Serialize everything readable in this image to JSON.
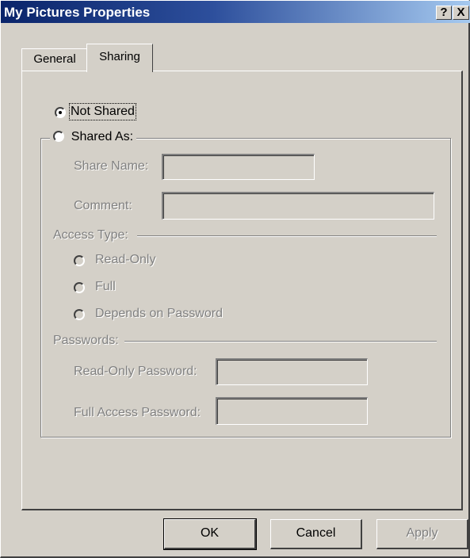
{
  "window": {
    "title": "My Pictures Properties",
    "help_label": "?",
    "close_label": "X"
  },
  "tabs": [
    {
      "label": "General",
      "selected": false
    },
    {
      "label": "Sharing",
      "selected": true
    }
  ],
  "sharing": {
    "not_shared": {
      "label": "Not Shared",
      "checked": true
    },
    "shared_as": {
      "label": "Shared As:",
      "checked": false
    },
    "share_name": {
      "label": "Share Name:",
      "value": ""
    },
    "comment": {
      "label": "Comment:",
      "value": ""
    },
    "access_type": {
      "label": "Access Type:",
      "options": [
        {
          "label": "Read-Only",
          "checked": false
        },
        {
          "label": "Full",
          "checked": false
        },
        {
          "label": "Depends on Password",
          "checked": false
        }
      ]
    },
    "passwords": {
      "label": "Passwords:",
      "read_only_password": {
        "label": "Read-Only Password:",
        "value": ""
      },
      "full_access_password": {
        "label": "Full Access Password:",
        "value": ""
      }
    }
  },
  "buttons": {
    "ok": "OK",
    "cancel": "Cancel",
    "apply": "Apply"
  },
  "colors": {
    "face": "#d4d0c8",
    "titlebar_start": "#0a246a",
    "titlebar_end": "#a6caf0",
    "disabled_text": "#808080"
  }
}
